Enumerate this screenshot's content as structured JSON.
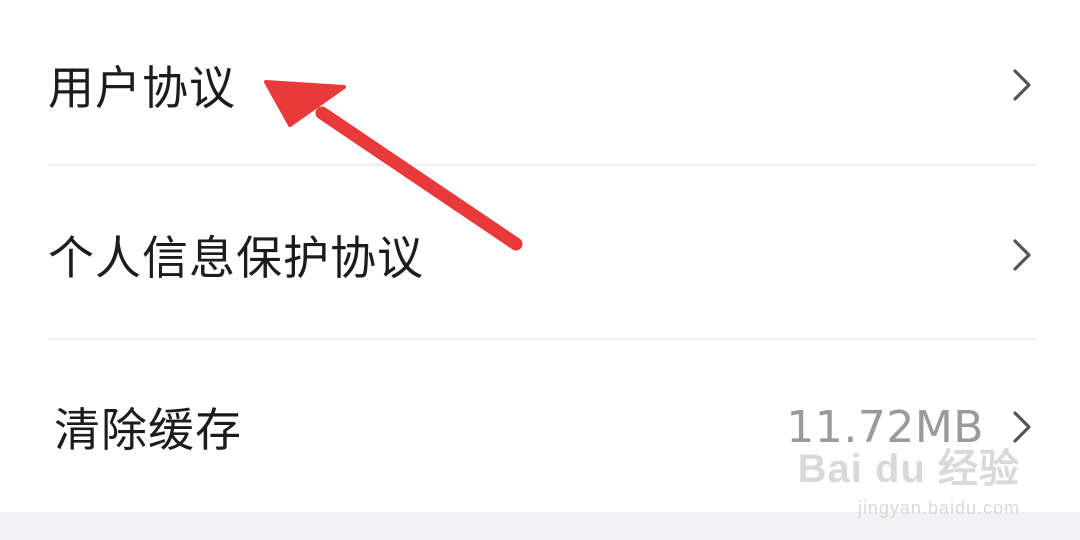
{
  "settings": {
    "items": [
      {
        "label": "用户协议",
        "icon": "chevron-right-icon"
      },
      {
        "label": "个人信息保护协议",
        "icon": "chevron-right-icon"
      },
      {
        "label": "清除缓存",
        "value": "11.72MB",
        "icon": "chevron-right-icon"
      }
    ]
  },
  "annotation": {
    "arrow_color": "#e8393b",
    "icon": "red-arrow-icon"
  },
  "watermark": {
    "brand": "Bai du 经验",
    "url": "jingyan.baidu.com"
  },
  "colors": {
    "background": "#ffffff",
    "text": "#1c1c1c",
    "value_text": "#9a9a9a",
    "divider": "#f0f0f0",
    "chevron": "#555555",
    "footer_band": "#f2f2f4"
  }
}
